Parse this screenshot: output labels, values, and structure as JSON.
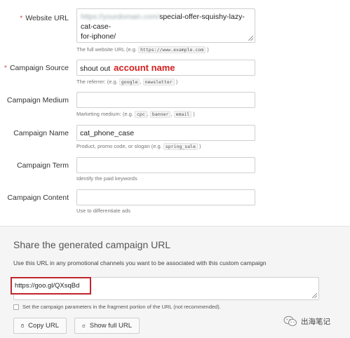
{
  "form": {
    "website_url": {
      "label": "Website URL",
      "required_mark": "*",
      "value_domain": "https://yourdomain.com/",
      "value_path_line1": "special-offer-squishy-lazy-cat-case-",
      "value_path_line2": "for-iphone/",
      "help_prefix": "The full website URL (e.g.",
      "help_example": "https://www.example.com",
      "help_suffix": ")"
    },
    "campaign_source": {
      "label": "Campaign Source",
      "required_mark": "*",
      "value": "shout out ",
      "annotation": "account name",
      "help_prefix": "The referrer: (e.g.",
      "help_example1": "google",
      "help_sep": ",",
      "help_example2": "newsletter",
      "help_suffix": ")"
    },
    "campaign_medium": {
      "label": "Campaign Medium",
      "value": "",
      "help_prefix": "Marketing medium: (e.g.",
      "help_example1": "cpc",
      "help_sep1": ",",
      "help_example2": "banner",
      "help_sep2": ",",
      "help_example3": "email",
      "help_suffix": ")"
    },
    "campaign_name": {
      "label": "Campaign Name",
      "value": "cat_phone_case",
      "help_prefix": "Product, promo code, or slogan (e.g.",
      "help_example": "spring_sale",
      "help_suffix": ")"
    },
    "campaign_term": {
      "label": "Campaign Term",
      "value": "",
      "help": "Identify the paid keywords"
    },
    "campaign_content": {
      "label": "Campaign Content",
      "value": "",
      "help": "Use to differentiate ads"
    }
  },
  "share": {
    "title": "Share the generated campaign URL",
    "description": "Use this URL in any promotional channels you want to be associated with this custom campaign",
    "generated_url": "https://goo.gl/QXsqBd",
    "fragment_option": "Set the campaign parameters in the fragment portion of the URL (not recommended).",
    "copy_button": "Copy URL",
    "show_full_button": "Show full URL"
  },
  "watermark": {
    "text": "出海笔记"
  },
  "colors": {
    "required": "#d9534f",
    "annotation": "#d32020",
    "highlight_border": "#c0262c",
    "panel_bg": "#f5f5f5"
  }
}
